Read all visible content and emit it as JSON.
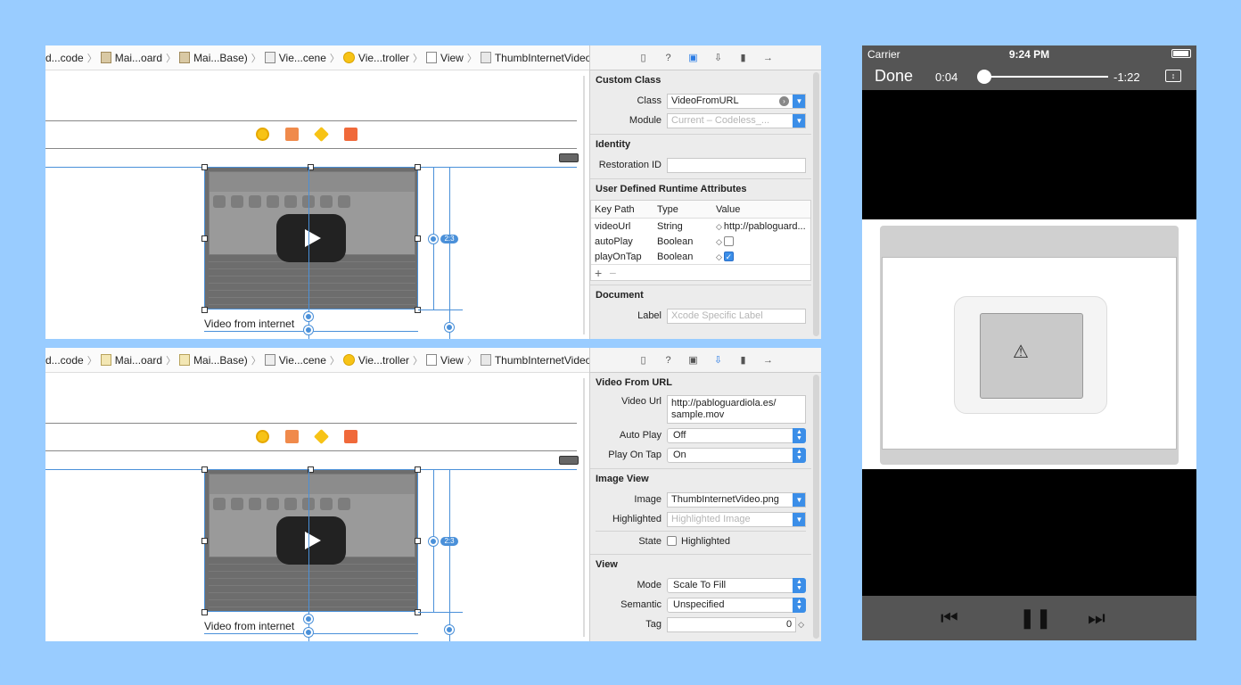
{
  "breadcrumbs_top": [
    "d...code",
    "Mai...oard",
    "Mai...Base)",
    "Vie...cene",
    "Vie...troller",
    "View",
    "ThumbInternetVideo.png"
  ],
  "breadcrumbs_bottom": [
    "d...code",
    "Mai...oard",
    "Mai...Base)",
    "Vie...cene",
    "Vie...troller",
    "View",
    "ThumbInternetVideo.png"
  ],
  "canvas": {
    "video_label": "Video from internet",
    "aspect_badge": "2:3"
  },
  "identity_inspector": {
    "custom_class": {
      "title": "Custom Class",
      "class_label": "Class",
      "class_value": "VideoFromURL",
      "module_label": "Module",
      "module_placeholder": "Current – Codeless_..."
    },
    "identity": {
      "title": "Identity",
      "restoration_label": "Restoration ID",
      "restoration_value": ""
    },
    "runtime_attributes": {
      "title": "User Defined Runtime Attributes",
      "headers": [
        "Key Path",
        "Type",
        "Value"
      ],
      "rows": [
        {
          "key": "videoUrl",
          "type": "String",
          "value": "http://pabloguard..."
        },
        {
          "key": "autoPlay",
          "type": "Boolean",
          "value": ""
        },
        {
          "key": "playOnTap",
          "type": "Boolean",
          "value": "✓"
        }
      ]
    },
    "document": {
      "title": "Document",
      "label_label": "Label",
      "label_placeholder": "Xcode Specific Label"
    }
  },
  "attributes_inspector": {
    "video_from_url": {
      "title": "Video From URL",
      "video_url_label": "Video Url",
      "video_url_line1": "http://pabloguardiola.es/",
      "video_url_line2": "sample.mov",
      "auto_play_label": "Auto Play",
      "auto_play_value": "Off",
      "play_on_tap_label": "Play On Tap",
      "play_on_tap_value": "On"
    },
    "image_view": {
      "title": "Image View",
      "image_label": "Image",
      "image_value": "ThumbInternetVideo.png",
      "highlighted_label": "Highlighted",
      "highlighted_placeholder": "Highlighted Image",
      "state_label": "State",
      "state_checkbox_label": "Highlighted"
    },
    "view": {
      "title": "View",
      "mode_label": "Mode",
      "mode_value": "Scale To Fill",
      "semantic_label": "Semantic",
      "semantic_value": "Unspecified",
      "tag_label": "Tag",
      "tag_value": "0"
    }
  },
  "simulator": {
    "carrier": "Carrier",
    "time": "9:24 PM",
    "done": "Done",
    "elapsed": "0:04",
    "remaining": "-1:22",
    "progress": 0.05
  },
  "icons": {
    "toolbar": [
      "file-icon",
      "help-icon",
      "identity-icon",
      "attributes-icon",
      "size-icon",
      "connections-icon"
    ],
    "transport": [
      "rewind-icon",
      "pause-icon",
      "fast-forward-icon"
    ]
  },
  "colors": {
    "background": "#99ccff",
    "accent": "#3b8ee8",
    "constraint": "#4a90d9"
  }
}
